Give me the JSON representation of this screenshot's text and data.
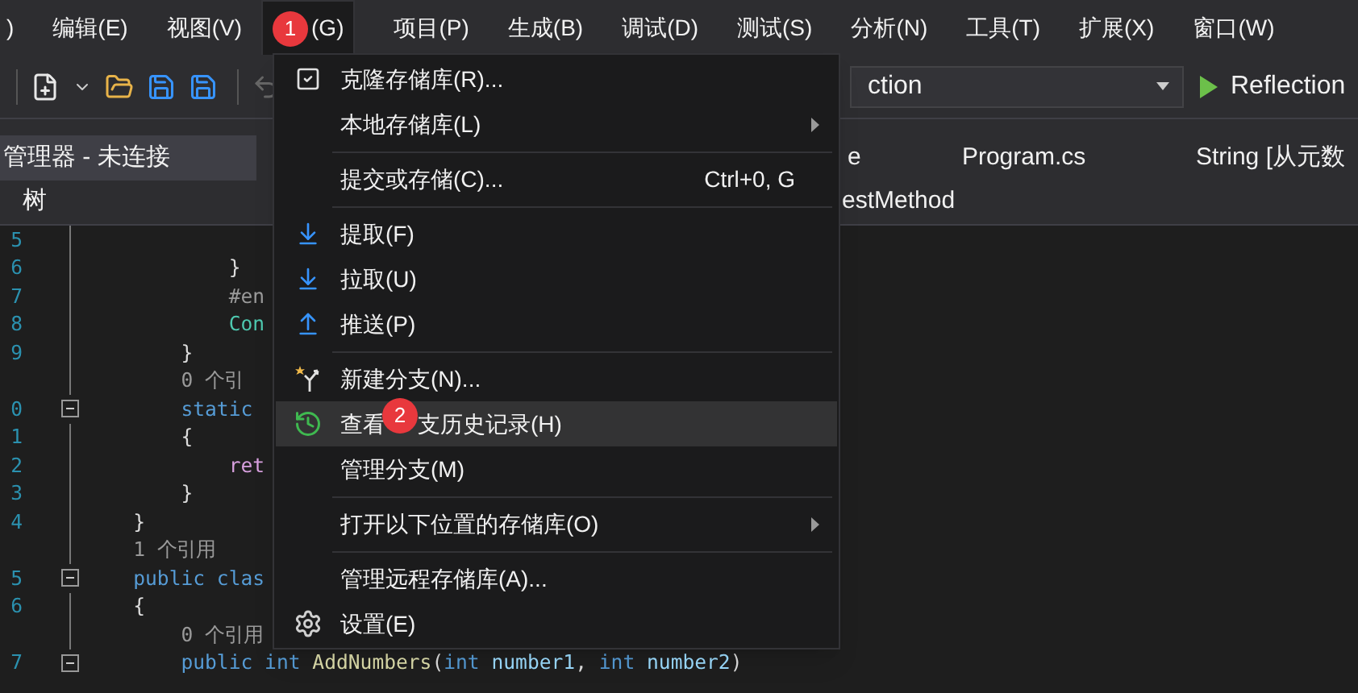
{
  "menubar": [
    {
      "label": ")",
      "selected": false
    },
    {
      "label": "编辑(E)",
      "selected": false
    },
    {
      "label": "视图(V)",
      "selected": false
    },
    {
      "label": "(G)",
      "selected": true,
      "badge": "1"
    },
    {
      "label": "项目(P)",
      "selected": false
    },
    {
      "label": "生成(B)",
      "selected": false
    },
    {
      "label": "调试(D)",
      "selected": false
    },
    {
      "label": "测试(S)",
      "selected": false
    },
    {
      "label": "分析(N)",
      "selected": false
    },
    {
      "label": "工具(T)",
      "selected": false
    },
    {
      "label": "扩展(X)",
      "selected": false
    },
    {
      "label": "窗口(W)",
      "selected": false
    }
  ],
  "toolbar": {
    "config_dropdown": "ction",
    "run_button": "Reflection"
  },
  "left_panel": {
    "title": "管理器 - 未连接",
    "subtitle": "树"
  },
  "tabs": [
    {
      "label": "e",
      "selected": false
    },
    {
      "label": "Program.cs",
      "selected": false
    },
    {
      "label": "String [从元数",
      "selected": false
    }
  ],
  "nav_bar": "estMethod",
  "code_lines": [
    {
      "number": "5",
      "fold": false
    },
    {
      "number": "6",
      "fold": false,
      "tokens": [
        {
          "text": "            }",
          "kind": "plain"
        }
      ]
    },
    {
      "number": "7",
      "fold": false,
      "tokens": [
        {
          "text": "            #en",
          "kind": "directive"
        }
      ]
    },
    {
      "number": "8",
      "fold": false,
      "tokens": [
        {
          "text": "            Con",
          "kind": "type"
        }
      ]
    },
    {
      "number": "9",
      "fold": false,
      "tokens": [
        {
          "text": "        }",
          "kind": "plain"
        }
      ]
    },
    {
      "fold": false,
      "tokens": [
        {
          "text": "        0 个引",
          "kind": "lens"
        }
      ]
    },
    {
      "number": "0",
      "fold": true,
      "tokens": [
        {
          "text": "        static",
          "kind": "keyword"
        }
      ]
    },
    {
      "number": "1",
      "fold": false,
      "tokens": [
        {
          "text": "        {",
          "kind": "plain"
        }
      ]
    },
    {
      "number": "2",
      "fold": false,
      "tokens": [
        {
          "text": "            ret",
          "kind": "control"
        }
      ]
    },
    {
      "number": "3",
      "fold": false,
      "tokens": [
        {
          "text": "        }",
          "kind": "plain"
        }
      ]
    },
    {
      "number": "4",
      "fold": false,
      "tokens": [
        {
          "text": "    }",
          "kind": "plain"
        }
      ]
    },
    {
      "fold": false,
      "tokens": [
        {
          "text": "    1 个引用",
          "kind": "lens"
        }
      ]
    },
    {
      "number": "5",
      "fold": true,
      "tokens": [
        {
          "text": "    public clas",
          "kind": "keyword"
        }
      ]
    },
    {
      "number": "6",
      "fold": false,
      "tokens": [
        {
          "text": "    {",
          "kind": "plain"
        }
      ]
    },
    {
      "fold": false,
      "tokens": [
        {
          "text": "        0 个引用",
          "kind": "lens"
        }
      ]
    },
    {
      "number": "7",
      "fold": true,
      "tokens": [
        {
          "text": "        public int ",
          "kind": "keyword"
        },
        {
          "text": "AddNumbers",
          "kind": "method"
        },
        {
          "text": "(",
          "kind": "plain"
        },
        {
          "text": "int ",
          "kind": "keyword"
        },
        {
          "text": "number1",
          "kind": "param"
        },
        {
          "text": ", ",
          "kind": "plain"
        },
        {
          "text": "int ",
          "kind": "keyword"
        },
        {
          "text": "number2",
          "kind": "param"
        },
        {
          "text": ")",
          "kind": "plain"
        }
      ]
    }
  ],
  "git_menu": [
    {
      "kind": "item",
      "label": "克隆存储库(R)...",
      "submenu": false,
      "selected": false
    },
    {
      "kind": "item",
      "label": "本地存储库(L)",
      "submenu": true,
      "selected": false
    },
    {
      "kind": "separator"
    },
    {
      "kind": "item",
      "label": "提交或存储(C)...",
      "shortcut": "Ctrl+0, G",
      "submenu": false,
      "selected": false
    },
    {
      "kind": "separator"
    },
    {
      "kind": "item",
      "label": "提取(F)",
      "submenu": false,
      "selected": false
    },
    {
      "kind": "item",
      "label": "拉取(U)",
      "submenu": false,
      "selected": false
    },
    {
      "kind": "item",
      "label": "推送(P)",
      "submenu": false,
      "selected": false
    },
    {
      "kind": "separator"
    },
    {
      "kind": "item",
      "label": "新建分支(N)...",
      "submenu": false,
      "selected": false
    },
    {
      "kind": "item",
      "label": "查看",
      "badge": "2",
      "label_after": "支历史记录(H)",
      "submenu": false,
      "selected": true
    },
    {
      "kind": "item",
      "label": "管理分支(M)",
      "submenu": false,
      "selected": false
    },
    {
      "kind": "separator"
    },
    {
      "kind": "item",
      "label": "打开以下位置的存储库(O)",
      "submenu": true,
      "selected": false
    },
    {
      "kind": "separator"
    },
    {
      "kind": "item",
      "label": "管理远程存储库(A)...",
      "submenu": false,
      "selected": false
    },
    {
      "kind": "item",
      "label": "设置(E)",
      "submenu": false,
      "selected": false
    }
  ]
}
